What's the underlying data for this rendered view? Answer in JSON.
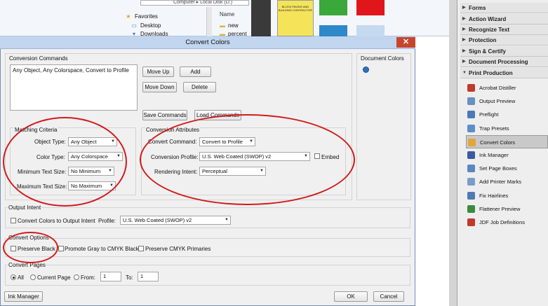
{
  "explorer": {
    "breadcrumb": "Computer ▸ Local Disk (D:)",
    "nav": [
      {
        "label": "Favorites",
        "icon": "star-icon"
      },
      {
        "label": "Desktop",
        "icon": "desktop-icon"
      },
      {
        "label": "Downloads",
        "icon": "downloads-icon"
      }
    ],
    "column_header": "Name",
    "folders": [
      "new",
      "percent"
    ],
    "thumbnail_text": "BLOCK PAVING AND BUILDING CONTRACTOR"
  },
  "tools_panel": {
    "sections": [
      "Forms",
      "Action Wizard",
      "Recognize Text",
      "Protection",
      "Sign & Certify",
      "Document Processing"
    ],
    "print_production": {
      "title": "Print Production",
      "items": [
        {
          "label": "Acrobat Distiller",
          "icon": "distiller-icon",
          "color": "#c0392b"
        },
        {
          "label": "Output Preview",
          "icon": "output-preview-icon",
          "color": "#6a8fc2"
        },
        {
          "label": "Preflight",
          "icon": "preflight-icon",
          "color": "#4d79b8"
        },
        {
          "label": "Trap Presets",
          "icon": "trap-presets-icon",
          "color": "#5c8fc7"
        },
        {
          "label": "Convert Colors",
          "icon": "convert-colors-icon",
          "color": "#e3a43a",
          "selected": true
        },
        {
          "label": "Ink Manager",
          "icon": "ink-manager-icon",
          "color": "#3b5ba0"
        },
        {
          "label": "Set Page Boxes",
          "icon": "set-page-boxes-icon",
          "color": "#5b87c0"
        },
        {
          "label": "Add Printer Marks",
          "icon": "printer-marks-icon",
          "color": "#7a9cc7"
        },
        {
          "label": "Fix Hairlines",
          "icon": "fix-hairlines-icon",
          "color": "#4f7bb5"
        },
        {
          "label": "Flattener Preview",
          "icon": "flattener-icon",
          "color": "#3d8a3d"
        },
        {
          "label": "JDF Job Definitions",
          "icon": "jdf-icon",
          "color": "#c0392b"
        }
      ]
    }
  },
  "dialog": {
    "title": "Convert Colors",
    "close_glyph": "✕",
    "conversion_commands": {
      "label": "Conversion Commands",
      "list_items": [
        "Any Object, Any Colorspace, Convert to Profile"
      ],
      "buttons": {
        "move_up": "Move Up",
        "add": "Add",
        "move_down": "Move Down",
        "delete": "Delete",
        "save": "Save Commands",
        "load": "Load Commands"
      }
    },
    "document_colors": {
      "label": "Document Colors"
    },
    "matching_criteria": {
      "label": "Matching Criteria",
      "object_type": {
        "label": "Object Type:",
        "value": "Any Object"
      },
      "color_type": {
        "label": "Color Type:",
        "value": "Any Colorspace"
      },
      "min_text": {
        "label": "Minimum Text Size:",
        "value": "No Minimum"
      },
      "max_text": {
        "label": "Maximum Text Size:",
        "value": "No Maximum"
      }
    },
    "conversion_attributes": {
      "label": "Conversion Attributes",
      "command": {
        "label": "Convert Command:",
        "value": "Convert to Profile"
      },
      "profile": {
        "label": "Conversion Profile:",
        "value": "U.S. Web Coated (SWOP) v2"
      },
      "embed": "Embed",
      "intent": {
        "label": "Rendering Intent:",
        "value": "Perceptual"
      }
    },
    "output_intent": {
      "label": "Output Intent",
      "checkbox": "Convert Colors to Output Intent",
      "profile_label": "Profile:",
      "profile_value": "U.S. Web Coated (SWOP) v2"
    },
    "convert_options": {
      "label": "Convert Options",
      "preserve_black": "Preserve Black",
      "promote_gray": "Promote Gray to CMYK Black",
      "preserve_cmyk": "Preserve CMYK Primaries"
    },
    "convert_pages": {
      "label": "Convert Pages",
      "all": "All",
      "current": "Current Page",
      "from": "From:",
      "from_value": "1",
      "to": "To:",
      "to_value": "1"
    },
    "footer": {
      "ink_manager": "Ink Manager",
      "ok": "OK",
      "cancel": "Cancel"
    }
  },
  "colors": {
    "annotation": "#d21b1b",
    "titlebar": "#c1d6ee",
    "close": "#c7452f"
  },
  "swatches": [
    "#3aa83a",
    "#e0161b",
    "#2f88c9",
    "#c5d9ef"
  ]
}
